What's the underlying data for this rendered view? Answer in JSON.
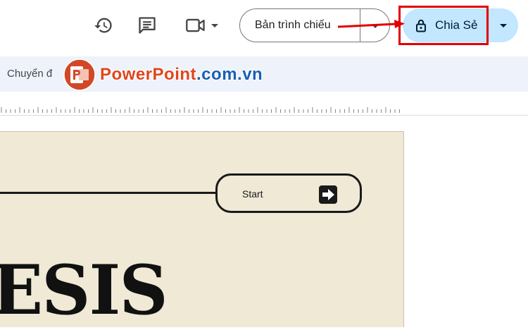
{
  "header": {
    "slideshow_label": "Bản trình chiếu",
    "share_label": "Chia Sẻ"
  },
  "toolbar": {
    "label": "Chuyển đ"
  },
  "watermark": {
    "text_part1": "PowerPoint",
    "text_part2": ".com.vn"
  },
  "slide": {
    "start_label": "Start",
    "title": "ESIS"
  },
  "icons": {
    "history": "history-icon",
    "comments": "comment-icon",
    "meet": "video-camera-icon",
    "share": "lock-icon"
  },
  "colors": {
    "share_bg": "#c2e7ff",
    "highlight": "#e10000",
    "slide_bg": "#efe9d6",
    "toolbar_bg": "#eef2fb"
  }
}
